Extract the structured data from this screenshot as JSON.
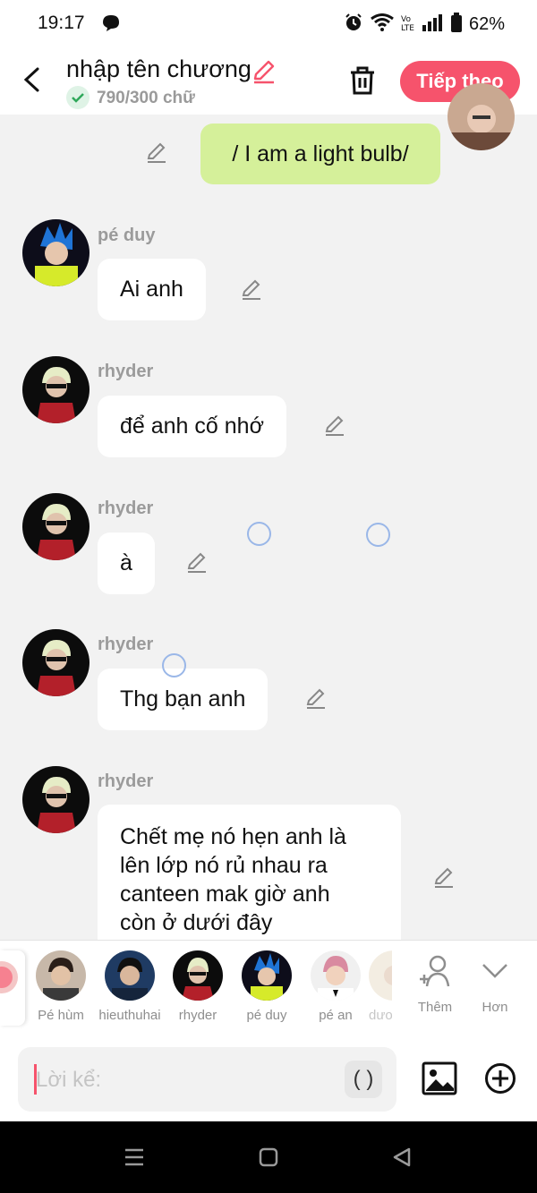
{
  "status_bar": {
    "time": "19:17",
    "battery_percent": "62%"
  },
  "header": {
    "title": "nhập tên chương",
    "word_count": "790/300 chữ",
    "next_button": "Tiếp theo"
  },
  "messages": [
    {
      "side": "right",
      "text": "/ I am a light bulb/"
    },
    {
      "sender": "pé duy",
      "text": "Ai anh"
    },
    {
      "sender": "rhyder",
      "text": "để anh cố nhớ"
    },
    {
      "sender": "rhyder",
      "text": "à"
    },
    {
      "sender": "rhyder",
      "text": "Thg bạn anh"
    },
    {
      "sender": "rhyder",
      "text_lines": [
        "Chết mẹ nó hẹn anh là",
        "lên lớp nó rủ nhau ra",
        "canteen mak giờ anh",
        "còn ở dưới đây"
      ]
    }
  ],
  "characters": [
    "Pé hùm",
    "hieuthuhai",
    "rhyder",
    "pé duy",
    "pé an",
    "dươ"
  ],
  "char_actions": {
    "add": "Thêm",
    "more": "Hơn"
  },
  "composer": {
    "placeholder": "Lời kể:",
    "paren_button": "( )"
  },
  "colors": {
    "accent": "#f6536c",
    "bubble_green": "#d5f09a",
    "background": "#f2f2f2"
  }
}
